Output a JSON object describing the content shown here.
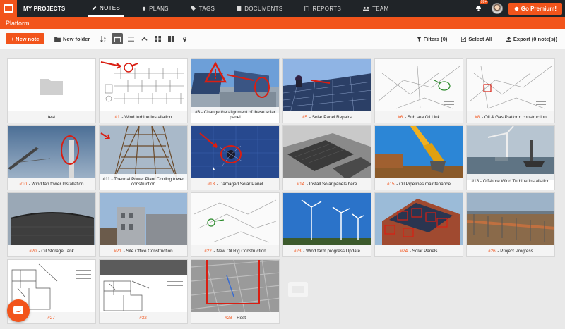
{
  "topbar": {
    "brand": "MY PROJECTS",
    "nav": [
      {
        "label": "NOTES",
        "icon": "pencil-icon",
        "active": true
      },
      {
        "label": "PLANS",
        "icon": "map-pin-icon",
        "active": false
      },
      {
        "label": "TAGS",
        "icon": "tag-icon",
        "active": false
      },
      {
        "label": "DOCUMENTS",
        "icon": "document-icon",
        "active": false
      },
      {
        "label": "REPORTS",
        "icon": "report-icon",
        "active": false
      },
      {
        "label": "TEAM",
        "icon": "team-icon",
        "active": false
      }
    ],
    "notification_badge": "99+",
    "premium_label": "Go Premium!"
  },
  "project_title": "Platform",
  "toolbar": {
    "new_note": "+ New note",
    "new_folder": "New folder",
    "filters": "Filters (0)",
    "select_all": "Select All",
    "export": "Export (0 note(s))"
  },
  "notes": [
    {
      "num": "",
      "title": "test",
      "thumb": "folder"
    },
    {
      "num": "#1",
      "title": "Wind turbine Installation",
      "thumb": "drawing-wind"
    },
    {
      "num": "#3",
      "title": "Change the alignment of these solar panel",
      "thumb": "solar-roof"
    },
    {
      "num": "#5",
      "title": "Solar Panel Repairs",
      "thumb": "solar-workers"
    },
    {
      "num": "#6",
      "title": "Sub sea Oil Link",
      "thumb": "map-green"
    },
    {
      "num": "#8",
      "title": "Oil & Gas Platform construction",
      "thumb": "map-red"
    },
    {
      "num": "#10",
      "title": "Wind fan tower Installation",
      "thumb": "tower-sky"
    },
    {
      "num": "#11",
      "title": "Thermal Power Plant Cooling tower construction",
      "thumb": "scaffold"
    },
    {
      "num": "#13",
      "title": "Damaged Solar Panel",
      "thumb": "solar-broken"
    },
    {
      "num": "#14",
      "title": "Install Solar panels here",
      "thumb": "solar-bw"
    },
    {
      "num": "#15",
      "title": "Oil Pipelines maintenance",
      "thumb": "excavator"
    },
    {
      "num": "#18",
      "title": "Offshore Wind Turbine Installation",
      "thumb": "offshore"
    },
    {
      "num": "#20",
      "title": "Oil Storage Tank",
      "thumb": "tank"
    },
    {
      "num": "#21",
      "title": "Site Office Construction",
      "thumb": "site-office"
    },
    {
      "num": "#22",
      "title": "New Oil Rig Construction",
      "thumb": "map-green2"
    },
    {
      "num": "#23",
      "title": "Wind farm progress Update",
      "thumb": "windfarm"
    },
    {
      "num": "#24",
      "title": "Solar Panels",
      "thumb": "solar-house"
    },
    {
      "num": "#26",
      "title": "Project Progress",
      "thumb": "progress"
    },
    {
      "num": "#27",
      "title": "",
      "thumb": "plan1"
    },
    {
      "num": "#32",
      "title": "",
      "thumb": "plan2"
    },
    {
      "num": "#28",
      "title": "Rest",
      "thumb": "ceiling"
    }
  ],
  "colors": {
    "accent": "#f2541b",
    "topbar": "#202428"
  }
}
